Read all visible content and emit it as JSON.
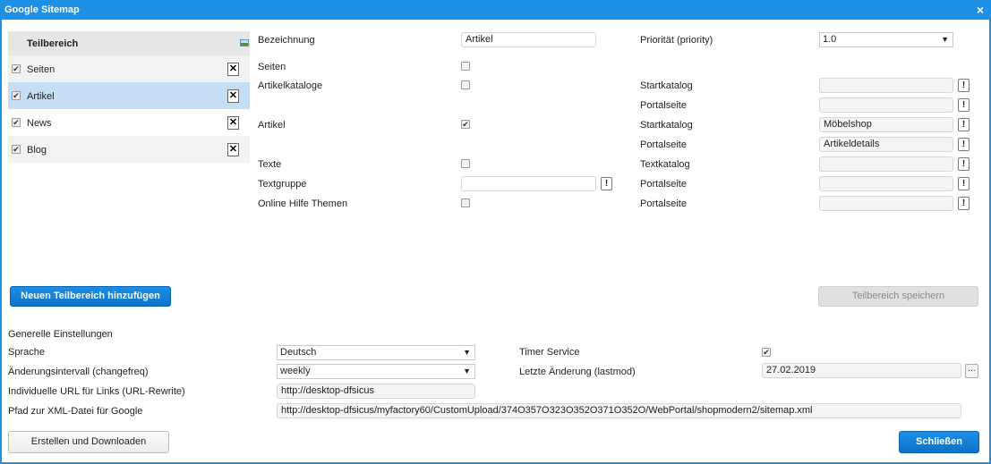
{
  "window": {
    "title": "Google Sitemap",
    "close_glyph": "×"
  },
  "sidebar": {
    "header": "Teilbereich",
    "header_icon": "image-icon",
    "items": [
      {
        "label": "Seiten",
        "checked": true,
        "selected": false
      },
      {
        "label": "Artikel",
        "checked": true,
        "selected": true
      },
      {
        "label": "News",
        "checked": true,
        "selected": false
      },
      {
        "label": "Blog",
        "checked": true,
        "selected": false
      }
    ],
    "delete_glyph": "✕"
  },
  "form": {
    "bezeichnung_label": "Bezeichnung",
    "bezeichnung_value": "Artikel",
    "prioritaet_label": "Priorität (priority)",
    "prioritaet_value": "1.0",
    "seiten_label": "Seiten",
    "artikelkataloge_label": "Artikelkataloge",
    "artikel_label": "Artikel",
    "texte_label": "Texte",
    "textgruppe_label": "Textgruppe",
    "textgruppe_value": "",
    "online_hilfe_label": "Online Hilfe Themen",
    "startkatalog_label": "Startkatalog",
    "portalseite_label": "Portalseite",
    "textkatalog_label": "Textkatalog",
    "artikelkataloge_startkatalog_value": "",
    "artikelkataloge_portalseite_value": "",
    "artikel_startkatalog_value": "Möbelshop",
    "artikel_portalseite_value": "Artikeldetails",
    "texte_textkatalog_value": "",
    "textgruppe_portalseite_value": "",
    "online_hilfe_portalseite_value": "",
    "picker_glyph": "!"
  },
  "buttons": {
    "add_section": "Neuen Teilbereich hinzufügen",
    "save_section": "Teilbereich speichern",
    "create_download": "Erstellen und Downloaden",
    "close": "Schließen"
  },
  "general": {
    "heading": "Generelle Einstellungen",
    "sprache_label": "Sprache",
    "sprache_value": "Deutsch",
    "changefreq_label": "Änderungsintervall (changefreq)",
    "changefreq_value": "weekly",
    "url_rewrite_label": "Individuelle URL für Links (URL-Rewrite)",
    "url_rewrite_value": "http://desktop-dfsicus",
    "xml_path_label": "Pfad zur XML-Datei für Google",
    "xml_path_value": "http://desktop-dfsicus/myfactory60/CustomUpload/374O357O323O352O371O352O/WebPortal/shopmodern2/sitemap.xml",
    "timer_service_label": "Timer Service",
    "timer_service_checked": true,
    "lastmod_label": "Letzte Änderung (lastmod)",
    "lastmod_value": "27.02.2019",
    "lastmod_picker": "..."
  },
  "colors": {
    "accent": "#1e90e6",
    "selected_row": "#c6ddf6"
  }
}
